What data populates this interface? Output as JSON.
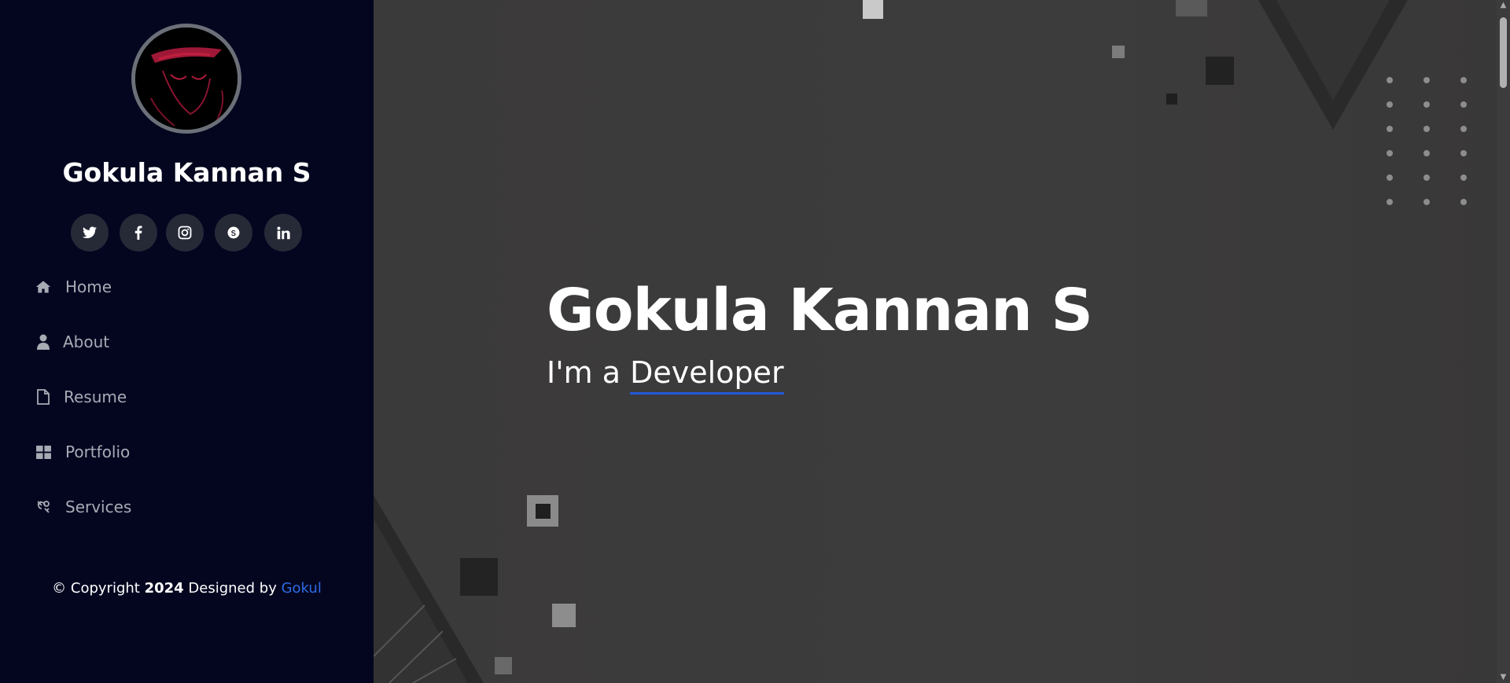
{
  "profile": {
    "name": "Gokula Kannan S"
  },
  "social": [
    {
      "name": "twitter-icon",
      "glyph": "🐦"
    },
    {
      "name": "facebook-icon",
      "glyph": "f"
    },
    {
      "name": "instagram-icon",
      "glyph": "◎"
    },
    {
      "name": "skype-icon",
      "glyph": "S"
    },
    {
      "name": "linkedin-icon",
      "glyph": "in"
    }
  ],
  "nav": [
    {
      "label": "Home",
      "icon": "home-icon"
    },
    {
      "label": "About",
      "icon": "user-icon"
    },
    {
      "label": "Resume",
      "icon": "file-icon"
    },
    {
      "label": "Portfolio",
      "icon": "grid-icon"
    },
    {
      "label": "Services",
      "icon": "services-icon"
    }
  ],
  "footer": {
    "prefix": "© Copyright ",
    "year": "2024",
    "middle": " Designed by ",
    "author": "Gokul"
  },
  "hero": {
    "title": "Gokula Kannan S",
    "prefix": "I'm a ",
    "typed": "Developer"
  },
  "colors": {
    "sidebar_bg": "#040620",
    "accent": "#2458d8",
    "link": "#2d6be3",
    "main_bg": "#3b3a3a"
  }
}
